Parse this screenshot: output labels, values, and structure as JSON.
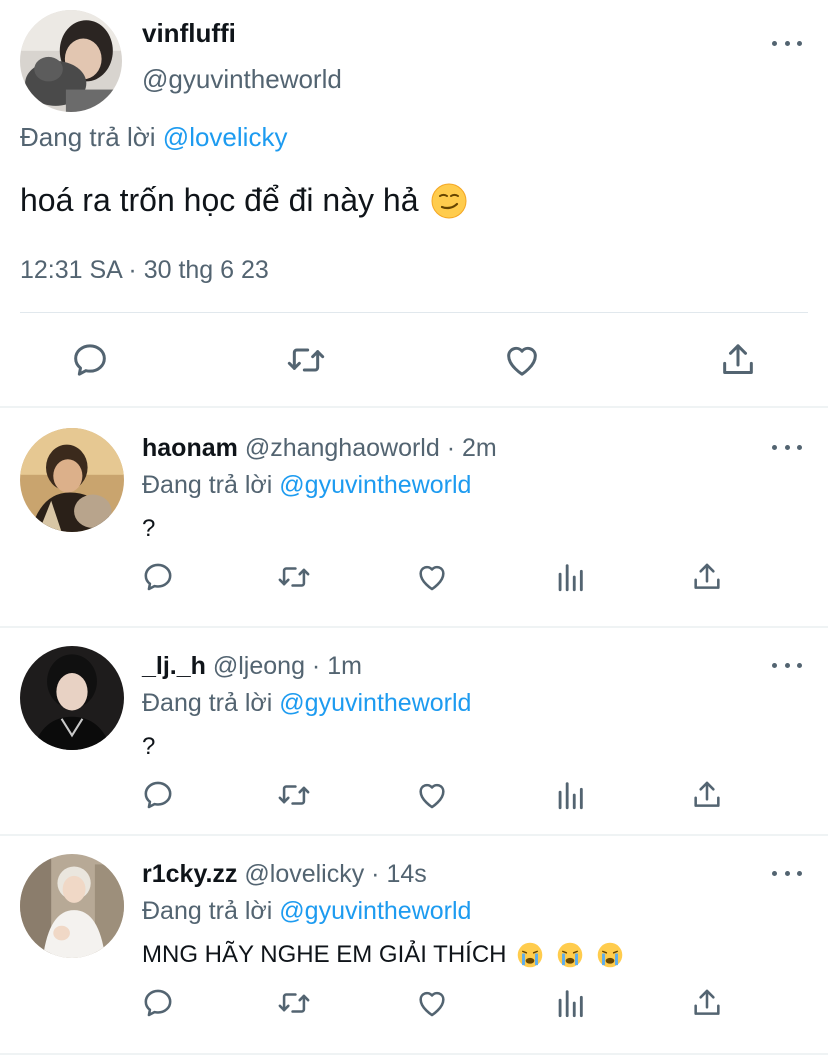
{
  "main_tweet": {
    "name": "vinfluffi",
    "handle": "@gyuvintheworld",
    "replying_prefix": "Đang trả lời",
    "replying_to": "@lovelicky",
    "text": "hoá ra trốn học để đi này hả",
    "text_emoji": "smirking-face",
    "timestamp": "12:31 SA · 30 thg 6 23",
    "actions": [
      "reply-icon",
      "retweet-icon",
      "like-icon",
      "share-icon"
    ]
  },
  "replies": [
    {
      "name": "haonam",
      "meta": "@zhanghaoworld · 2m",
      "replying_prefix": "Đang trả lời",
      "replying_to": "@gyuvintheworld",
      "text": "?",
      "emojis": []
    },
    {
      "name": "_lj._h",
      "meta": "@ljeong · 1m",
      "replying_prefix": "Đang trả lời",
      "replying_to": "@gyuvintheworld",
      "text": "?",
      "emojis": []
    },
    {
      "name": "r1cky.zz",
      "meta": "@lovelicky · 14s",
      "replying_prefix": "Đang trả lời",
      "replying_to": "@gyuvintheworld",
      "text": "MNG HÃY NGHE EM GIẢI THÍCH",
      "emojis": [
        "loudly-crying-face",
        "loudly-crying-face",
        "loudly-crying-face"
      ]
    }
  ],
  "colors": {
    "accent": "#1d9bf0",
    "secondary_text": "#536471",
    "primary_text": "#0f1419",
    "divider": "#eff3f4"
  }
}
